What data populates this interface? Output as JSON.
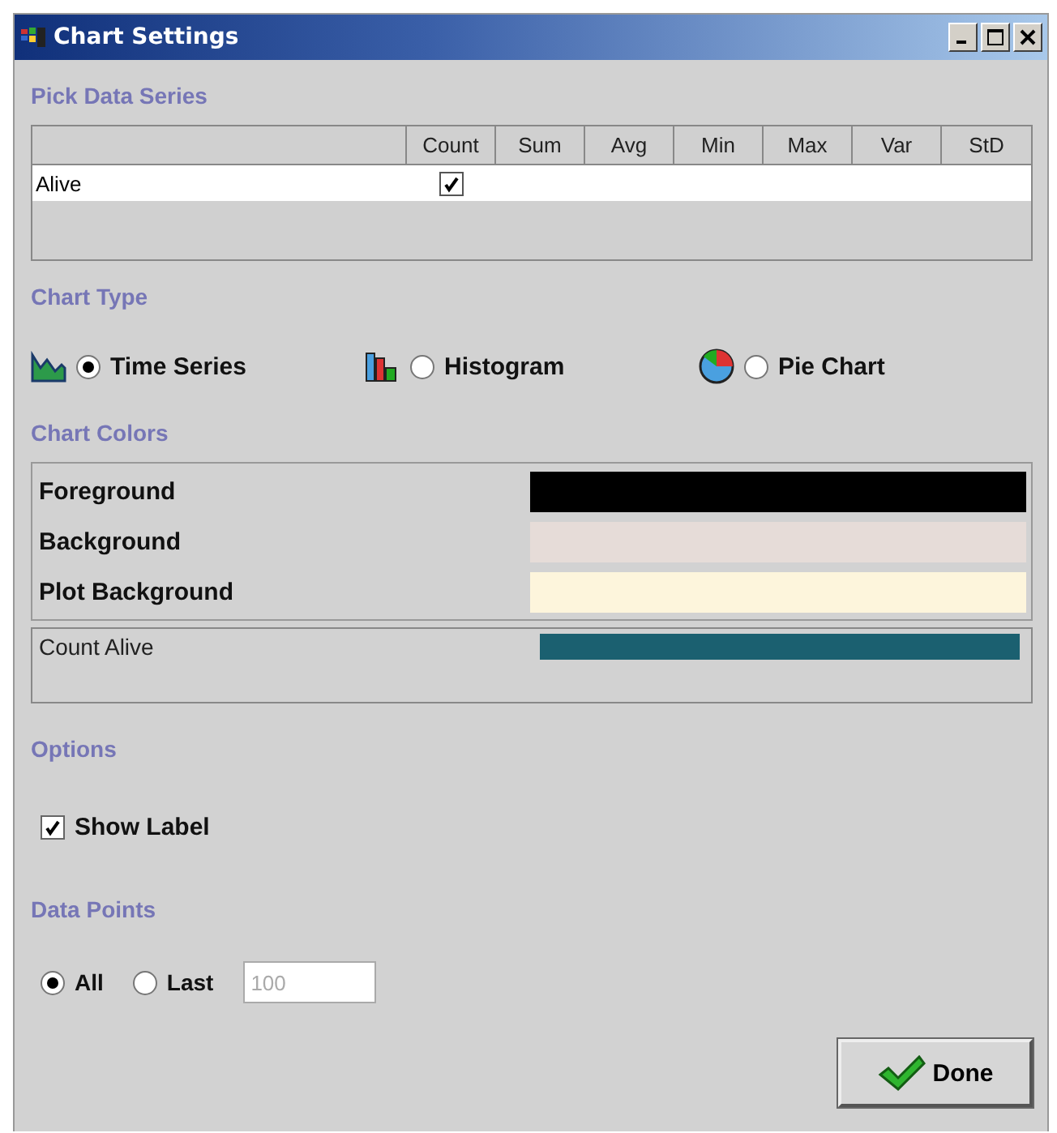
{
  "window": {
    "title": "Chart Settings"
  },
  "series_table": {
    "title": "Pick Data Series",
    "columns": [
      "Count",
      "Sum",
      "Avg",
      "Min",
      "Max",
      "Var",
      "StD"
    ],
    "rows": [
      {
        "name": "Alive",
        "checks": [
          true,
          false,
          false,
          false,
          false,
          false,
          false
        ]
      }
    ]
  },
  "chart_type": {
    "title": "Chart Type",
    "options": [
      {
        "label": "Time Series",
        "kind": "line",
        "selected": true
      },
      {
        "label": "Histogram",
        "kind": "bar",
        "selected": false
      },
      {
        "label": "Pie Chart",
        "kind": "pie",
        "selected": false
      }
    ]
  },
  "chart_colors": {
    "title": "Chart Colors",
    "items": [
      {
        "label": "Foreground",
        "color": "#000000"
      },
      {
        "label": "Background",
        "color": "#e6dcd8"
      },
      {
        "label": "Plot Background",
        "color": "#fdf5dc"
      }
    ],
    "series": [
      {
        "label": "Count Alive",
        "color": "#1b6070"
      }
    ]
  },
  "options": {
    "title": "Options",
    "show_label": {
      "label": "Show Label",
      "checked": true
    }
  },
  "data_points": {
    "title": "Data Points",
    "modes": [
      {
        "label": "All",
        "selected": true
      },
      {
        "label": "Last",
        "selected": false
      }
    ],
    "count_field": {
      "value": "100",
      "disabled": true
    }
  },
  "buttons": [
    {
      "label": "Done"
    }
  ]
}
